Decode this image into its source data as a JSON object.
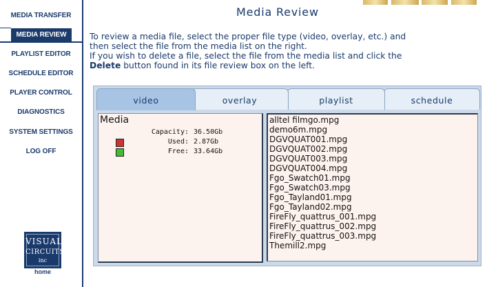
{
  "sidebar": {
    "items": [
      {
        "label": "MEDIA TRANSFER",
        "active": false
      },
      {
        "label": "MEDIA REVIEW",
        "active": true
      },
      {
        "label": "PLAYLIST EDITOR",
        "active": false
      },
      {
        "label": "SCHEDULE EDITOR",
        "active": false
      },
      {
        "label": "PLAYER CONTROL",
        "active": false
      },
      {
        "label": "DIAGNOSTICS",
        "active": false
      },
      {
        "label": "SYSTEM SETTINGS",
        "active": false
      },
      {
        "label": "LOG OFF",
        "active": false
      }
    ],
    "logo": {
      "line1": "VISUAL",
      "line2": "CIRCUITS",
      "line3": "inc"
    },
    "home_label": "home"
  },
  "header": {
    "title": "Media Review"
  },
  "instructions": {
    "line1": "To review a media file, select the proper file type (video, overlay, etc.) and",
    "line2": "then select the file from the media list on the right.",
    "line3": "If you wish to delete a file, select the file from the media list and click the",
    "line4_bold": "Delete",
    "line4_rest": " button found in its file review box on the left."
  },
  "tabs": [
    {
      "label": "video",
      "active": true
    },
    {
      "label": "overlay",
      "active": false
    },
    {
      "label": "playlist",
      "active": false
    },
    {
      "label": "schedule",
      "active": false
    }
  ],
  "media_stats": {
    "title": "Media",
    "capacity_label": "Capacity:",
    "capacity_value": "36.50Gb",
    "used_label": "Used:",
    "used_value": "2.87Gb",
    "free_label": "Free:",
    "free_value": "33.64Gb"
  },
  "colors": {
    "brand": "#1a3a6b",
    "used": "#cc3333",
    "free": "#44bb33"
  },
  "files": [
    "alltel filmgo.mpg",
    "demo6m.mpg",
    "DGVQUAT001.mpg",
    "DGVQUAT002.mpg",
    "DGVQUAT003.mpg",
    "DGVQUAT004.mpg",
    "Fgo_Swatch01.mpg",
    "Fgo_Swatch03.mpg",
    "Fgo_Tayland01.mpg",
    "Fgo_Tayland02.mpg",
    "FireFly_quattrus_001.mpg",
    "FireFly_quattrus_002.mpg",
    "FireFly_quattrus_003.mpg",
    "Themill2.mpg"
  ]
}
